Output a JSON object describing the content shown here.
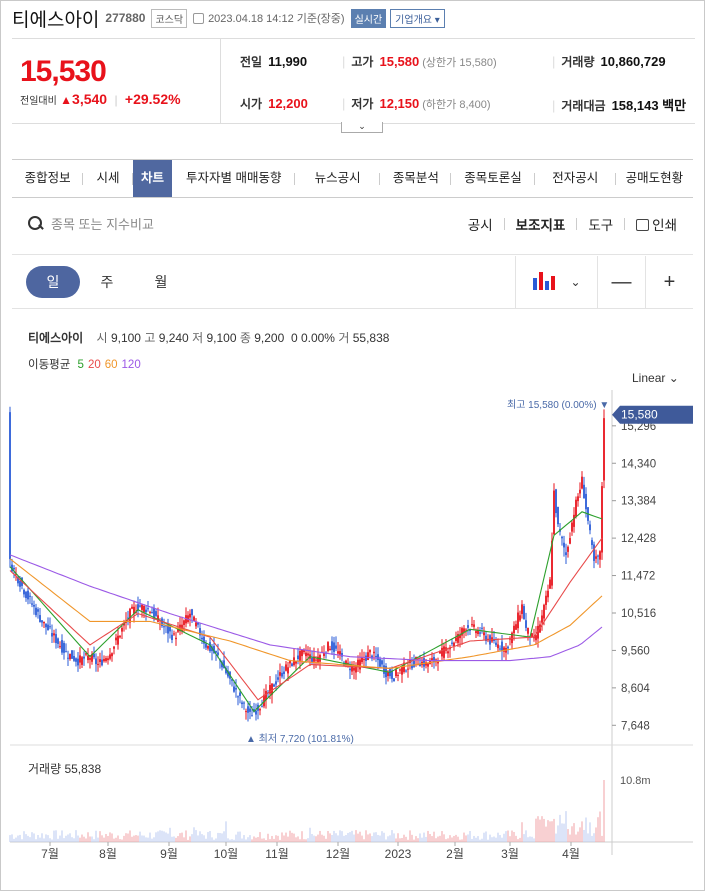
{
  "stock": {
    "name": "티에스아이",
    "code": "277880",
    "market": "코스닥",
    "datetime": "2023.04.18 14:12 기준(장중)",
    "live_badge": "실시간",
    "company_badge": "기업개요 ▾",
    "price": "15,530",
    "change_label": "전일대비",
    "change_arrow": "▲",
    "change_value": "3,540",
    "change_rate": "+29.52%",
    "toggle_icon": "chevron-down-icon"
  },
  "quote": {
    "prev_close": {
      "label": "전일",
      "value": "11,990"
    },
    "high": {
      "label": "고가",
      "value": "15,580",
      "sub": "(상한가 15,580)"
    },
    "volume": {
      "label": "거래량",
      "value": "10,860,729"
    },
    "open": {
      "label": "시가",
      "value": "12,200"
    },
    "low": {
      "label": "저가",
      "value": "12,150",
      "sub": "(하한가 8,400)"
    },
    "amount": {
      "label": "거래대금",
      "value": "158,143 백만"
    }
  },
  "tabs": [
    "종합정보",
    "시세",
    "차트",
    "투자자별 매매동향",
    "뉴스공시",
    "종목분석",
    "종목토론실",
    "전자공시",
    "공매도현황"
  ],
  "active_tab": "차트",
  "toolbar": {
    "search_placeholder": "종목 또는 지수비교",
    "disclosure": "공시",
    "indicator": "보조지표",
    "tools": "도구",
    "print": "인쇄"
  },
  "periods": [
    "일",
    "주",
    "월"
  ],
  "active_period": "일",
  "zoom": {
    "minus": "—",
    "plus": "+"
  },
  "chart_legend": {
    "name": "티에스아이",
    "open_label": "시",
    "open": "9,100",
    "high_label": "고",
    "high": "9,240",
    "low_label": "저",
    "low": "9,100",
    "close_label": "종",
    "close": "9,200",
    "change": "0 0.00%",
    "vol_label": "거",
    "vol": "55,838",
    "ma_label": "이동평균",
    "ma": [
      {
        "period": "5",
        "color": "#2ca02c"
      },
      {
        "period": "20",
        "color": "#e84a4a"
      },
      {
        "period": "60",
        "color": "#f0962a"
      },
      {
        "period": "120",
        "color": "#9b59e6"
      }
    ],
    "scale": "Linear ⌄"
  },
  "colors": {
    "up": "#e8121b",
    "down": "#2a5bd7",
    "accent": "#5068a0"
  },
  "chart_data": {
    "type": "candlestick",
    "x_ticks": [
      "7월",
      "8월",
      "9월",
      "10월",
      "11월",
      "12월",
      "2023",
      "2월",
      "3월",
      "4월"
    ],
    "y_ticks": [
      15296,
      14340,
      13384,
      12428,
      11472,
      10516,
      9560,
      8604,
      7648
    ],
    "y_tick_labels": [
      "15,296",
      "14,340",
      "13,384",
      "12,428",
      "11,472",
      "10,516",
      "9,560",
      "8,604",
      "7,648"
    ],
    "ylim": [
      7400,
      15700
    ],
    "current_price_label": "15,580",
    "max_annotation": "최고 15,580 (0.00%) ▼",
    "min_annotation": "▲ 최저 7,720 (101.81%)",
    "volume_label": "거래량 55,838",
    "volume_max_label": "10.8m",
    "close_path": [
      [
        0,
        11800
      ],
      [
        8,
        11000
      ],
      [
        16,
        10300
      ],
      [
        22,
        9900
      ],
      [
        28,
        9500
      ],
      [
        34,
        9300
      ],
      [
        40,
        9400
      ],
      [
        44,
        9200
      ],
      [
        50,
        9500
      ],
      [
        56,
        10100
      ],
      [
        60,
        10500
      ],
      [
        64,
        10700
      ],
      [
        70,
        10600
      ],
      [
        76,
        10200
      ],
      [
        82,
        9900
      ],
      [
        86,
        10200
      ],
      [
        90,
        10500
      ],
      [
        94,
        10100
      ],
      [
        98,
        9700
      ],
      [
        104,
        9400
      ],
      [
        108,
        9000
      ],
      [
        112,
        8600
      ],
      [
        116,
        8200
      ],
      [
        120,
        7900
      ],
      [
        124,
        8100
      ],
      [
        128,
        8400
      ],
      [
        132,
        8700
      ],
      [
        136,
        9000
      ],
      [
        140,
        9200
      ],
      [
        144,
        9400
      ],
      [
        148,
        9500
      ],
      [
        152,
        9300
      ],
      [
        156,
        9500
      ],
      [
        160,
        9700
      ],
      [
        164,
        9500
      ],
      [
        168,
        9200
      ],
      [
        172,
        9100
      ],
      [
        176,
        9300
      ],
      [
        180,
        9500
      ],
      [
        184,
        9300
      ],
      [
        188,
        9000
      ],
      [
        192,
        8900
      ],
      [
        196,
        9100
      ],
      [
        200,
        9200
      ],
      [
        204,
        9300
      ],
      [
        208,
        9200
      ],
      [
        212,
        9300
      ],
      [
        216,
        9500
      ],
      [
        220,
        9700
      ],
      [
        224,
        9900
      ],
      [
        228,
        10200
      ],
      [
        232,
        10100
      ],
      [
        236,
        10000
      ],
      [
        240,
        9800
      ],
      [
        244,
        9700
      ],
      [
        248,
        9600
      ],
      [
        252,
        10100
      ],
      [
        256,
        10700
      ],
      [
        258,
        10100
      ],
      [
        262,
        9800
      ],
      [
        266,
        10400
      ],
      [
        270,
        11300
      ],
      [
        272,
        13600
      ],
      [
        274,
        12700
      ],
      [
        278,
        12000
      ],
      [
        282,
        13100
      ],
      [
        286,
        13900
      ],
      [
        290,
        12500
      ],
      [
        292,
        11800
      ],
      [
        295,
        12000
      ],
      [
        297,
        15580
      ]
    ],
    "ma5_path": [
      [
        0,
        11700
      ],
      [
        40,
        9400
      ],
      [
        64,
        10600
      ],
      [
        100,
        9700
      ],
      [
        122,
        8000
      ],
      [
        150,
        9400
      ],
      [
        190,
        9000
      ],
      [
        230,
        10100
      ],
      [
        260,
        9900
      ],
      [
        272,
        12500
      ],
      [
        286,
        13100
      ],
      [
        297,
        12900
      ]
    ],
    "ma20_path": [
      [
        0,
        11600
      ],
      [
        40,
        9700
      ],
      [
        64,
        10500
      ],
      [
        100,
        9900
      ],
      [
        124,
        8300
      ],
      [
        150,
        9200
      ],
      [
        190,
        9100
      ],
      [
        230,
        9800
      ],
      [
        262,
        9900
      ],
      [
        280,
        11300
      ],
      [
        297,
        12500
      ]
    ],
    "ma60_path": [
      [
        0,
        11900
      ],
      [
        40,
        10300
      ],
      [
        70,
        10300
      ],
      [
        110,
        9800
      ],
      [
        140,
        9300
      ],
      [
        190,
        9100
      ],
      [
        230,
        9400
      ],
      [
        262,
        9700
      ],
      [
        280,
        10200
      ],
      [
        297,
        11000
      ]
    ],
    "ma120_path": [
      [
        0,
        12000
      ],
      [
        40,
        11200
      ],
      [
        80,
        10500
      ],
      [
        130,
        9700
      ],
      [
        170,
        9400
      ],
      [
        210,
        9300
      ],
      [
        250,
        9300
      ],
      [
        270,
        9400
      ],
      [
        285,
        9700
      ],
      [
        297,
        10200
      ]
    ]
  }
}
